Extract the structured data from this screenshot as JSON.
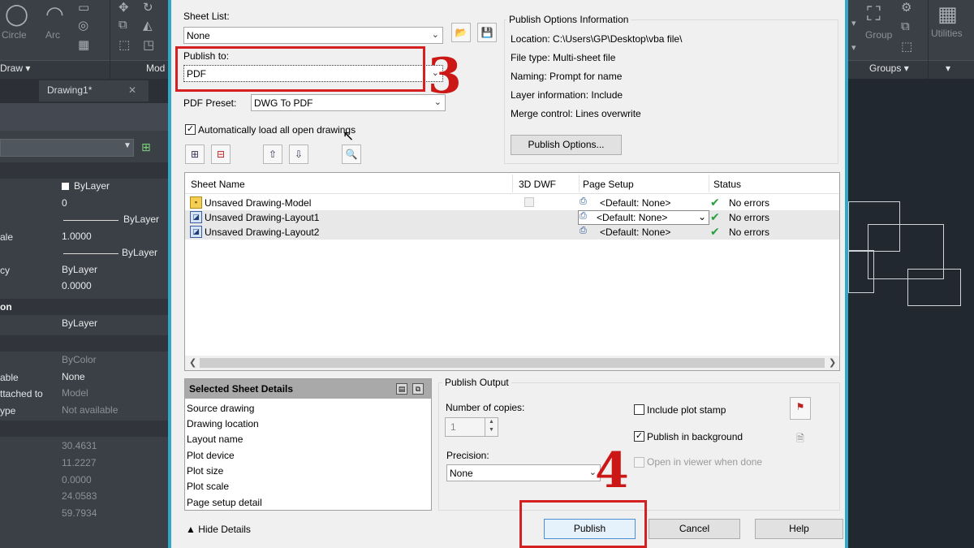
{
  "ribbon": {
    "groups_left": [
      "Circle",
      "Arc"
    ],
    "panel_draw": "Draw",
    "panel_modify": "Mod",
    "group_label": "Group",
    "utilities_label": "Utilities",
    "panel_groups": "Groups"
  },
  "doc_tab": {
    "title": "Drawing1*",
    "close": "✕"
  },
  "properties": [
    {
      "label": "",
      "value": "ByLayer",
      "swatch": true
    },
    {
      "label": "",
      "value": "0"
    },
    {
      "label": "",
      "value": "ByLayer",
      "line": true
    },
    {
      "label": "ale",
      "value": "1.0000"
    },
    {
      "label": "",
      "value": "ByLayer",
      "line": true
    },
    {
      "label": "cy",
      "value": "ByLayer"
    },
    {
      "label": "",
      "value": "0.0000"
    },
    {
      "section": "on"
    },
    {
      "label": "",
      "value": "ByLayer"
    },
    {
      "label": "",
      "value": "ByColor",
      "dim": true
    },
    {
      "label": "able",
      "value": "None"
    },
    {
      "label": "ttached to",
      "value": "Model",
      "dim": true
    },
    {
      "label": "ype",
      "value": "Not available",
      "dim": true
    },
    {
      "label": "",
      "value": "30.4631",
      "dim": true
    },
    {
      "label": "",
      "value": "11.2227",
      "dim": true
    },
    {
      "label": "",
      "value": "0.0000",
      "dim": true
    },
    {
      "label": "",
      "value": "24.0583",
      "dim": true
    },
    {
      "label": "",
      "value": "59.7934",
      "dim": true
    }
  ],
  "dialog": {
    "sheet_list_label": "Sheet List:",
    "sheet_list_value": "None",
    "publish_to_label": "Publish to:",
    "publish_to_value": "PDF",
    "pdf_preset_label": "PDF Preset:",
    "pdf_preset_value": "DWG To PDF",
    "auto_load_label": "Automatically load all open drawings",
    "options_info": {
      "title": "Publish Options Information",
      "location": "Location: C:\\Users\\GP\\Desktop\\vba file\\",
      "file_type": "File type: Multi-sheet file",
      "naming": "Naming: Prompt for name",
      "layer_info": "Layer information: Include",
      "merge": "Merge control: Lines overwrite",
      "button": "Publish Options..."
    },
    "table": {
      "headers": [
        "Sheet Name",
        "3D DWF",
        "Page Setup",
        "Status"
      ],
      "rows": [
        {
          "name": "Unsaved Drawing-Model",
          "page_setup": "<Default: None>",
          "status": "No errors"
        },
        {
          "name": "Unsaved Drawing-Layout1",
          "page_setup": "<Default: None>",
          "status": "No errors"
        },
        {
          "name": "Unsaved Drawing-Layout2",
          "page_setup": "<Default: None>",
          "status": "No errors"
        }
      ]
    },
    "details": {
      "title": "Selected Sheet Details",
      "items": [
        "Source drawing",
        "Drawing location",
        "Layout name",
        "Plot device",
        "Plot size",
        "Plot scale",
        "Page setup detail"
      ]
    },
    "output": {
      "title": "Publish Output",
      "copies_label": "Number of copies:",
      "copies_value": "1",
      "precision_label": "Precision:",
      "precision_value": "None",
      "include_stamp": "Include plot stamp",
      "publish_background": "Publish in background",
      "open_viewer": "Open in viewer when done"
    },
    "hide_details": "Hide Details",
    "buttons": {
      "publish": "Publish",
      "cancel": "Cancel",
      "help": "Help"
    }
  },
  "annotations": {
    "step3": "3",
    "step4": "4",
    "accent": "#d42020"
  }
}
